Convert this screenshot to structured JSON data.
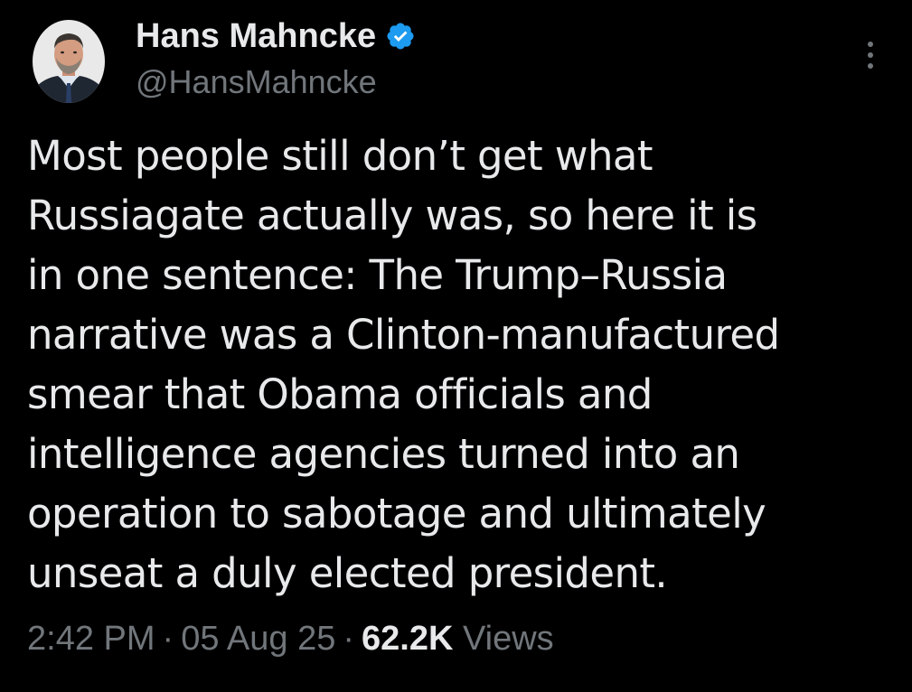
{
  "author": {
    "display_name": "Hans Mahncke",
    "handle": "@HansMahncke",
    "verified": true,
    "verified_icon": "verified-badge-icon",
    "verified_color": "#1d9bf0"
  },
  "tweet": {
    "lines": [
      "Most people still don’t get what",
      "Russiagate actually was, so here it is",
      "in one sentence: The Trump–Russia",
      "narrative was a Clinton-manufactured",
      "smear that Obama officials and",
      "intelligence agencies turned into an",
      "operation to sabotage and ultimately",
      "unseat a duly elected president."
    ]
  },
  "meta": {
    "time": "2:42 PM",
    "separator": "·",
    "date": "05 Aug 25",
    "views_count": "62.2K",
    "views_label": "Views"
  },
  "menu": {
    "icon": "more-options-icon"
  },
  "colors": {
    "background": "#000000",
    "text": "#e7e9ea",
    "secondary": "#71767b"
  }
}
